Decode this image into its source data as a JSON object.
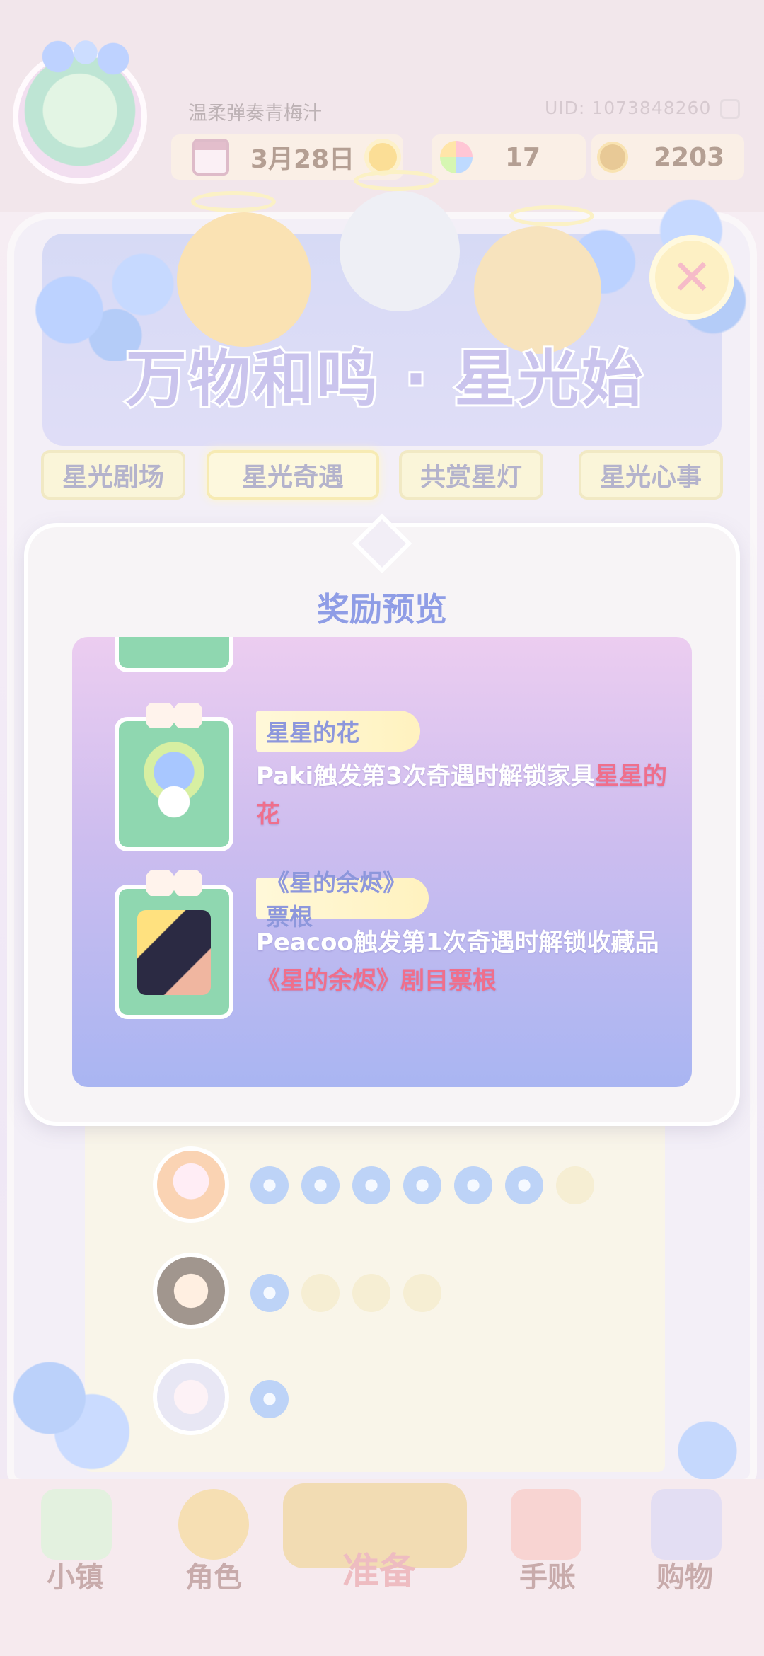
{
  "header": {
    "username": "温柔弹奏青梅汁",
    "uid": "UID: 1073848260",
    "date": "3月28日",
    "star_count": "17",
    "coin_count": "2203"
  },
  "event": {
    "title": "万物和鸣 · 星光始",
    "tabs": [
      "星光剧场",
      "星光奇遇",
      "共赏星灯",
      "星光心事"
    ],
    "selected_tab": "星光奇遇"
  },
  "modal": {
    "title": "奖励预览",
    "rewards": [
      {
        "name": "星星的花",
        "desc_prefix": "Paki触发第3次奇遇时解锁家具",
        "desc_highlight": "星星的花"
      },
      {
        "name": "《星的余烬》票根",
        "desc_prefix": "Peacoo触发第1次奇遇时解锁收藏品",
        "desc_highlight": "《星的余烬》剧目票根"
      }
    ]
  },
  "progress": [
    {
      "character": "row1",
      "filled": 6,
      "total": 7
    },
    {
      "character": "row2",
      "filled": 1,
      "total": 4
    },
    {
      "character": "row3",
      "filled": 1,
      "total": 1
    }
  ],
  "bottom_nav": {
    "items": [
      "小镇",
      "角色",
      "准备",
      "手账",
      "购物"
    ],
    "active": "准备"
  },
  "colors": {
    "accent_pink": "#ef6f8c",
    "title_periwinkle": "#8f9de6",
    "tab_yellow": "#f6eebe"
  }
}
